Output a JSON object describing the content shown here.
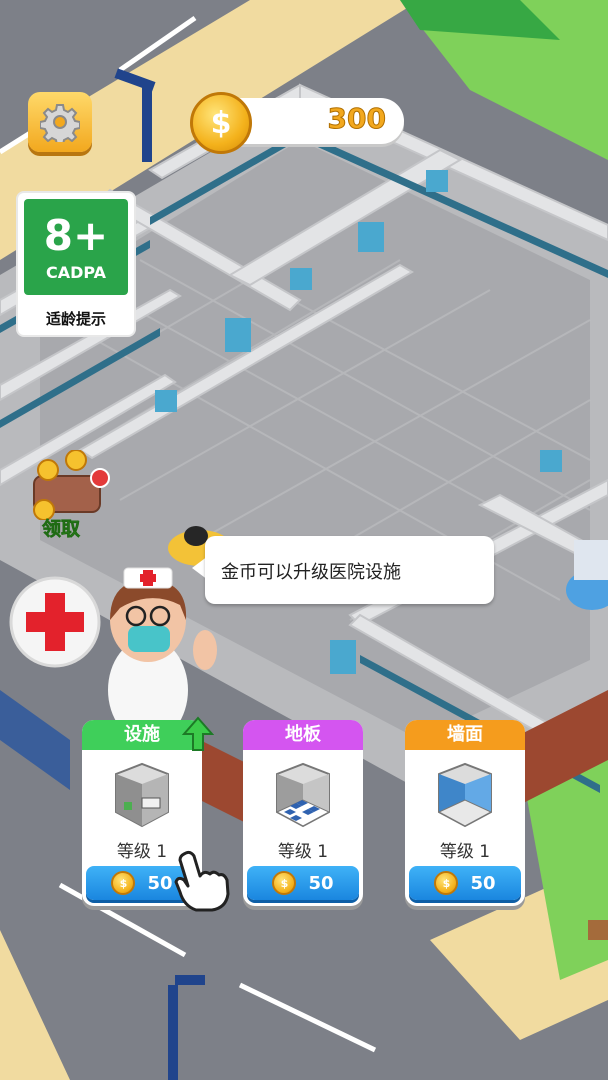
{
  "hud": {
    "settings_icon": "gear-icon",
    "coin_icon": "coin-icon",
    "coin_symbol": "$",
    "coins": "300"
  },
  "age_rating": {
    "age": "8+",
    "org": "CADPA",
    "tip": "适龄提示"
  },
  "collect": {
    "label": "领取"
  },
  "tutorial": {
    "message": "金币可以升级医院设施"
  },
  "upgrade_cards": [
    {
      "title": "设施",
      "level": "等级 1",
      "cost": "50",
      "color": "#3fcf5a"
    },
    {
      "title": "地板",
      "level": "等级 1",
      "cost": "50",
      "color": "#d455f0"
    },
    {
      "title": "墙面",
      "level": "等级 1",
      "cost": "50",
      "color": "#f59c1d"
    }
  ],
  "colors": {
    "accent_coin": "#f2a81e",
    "button_blue": "#1a86df",
    "grass": "#7fd15a"
  }
}
